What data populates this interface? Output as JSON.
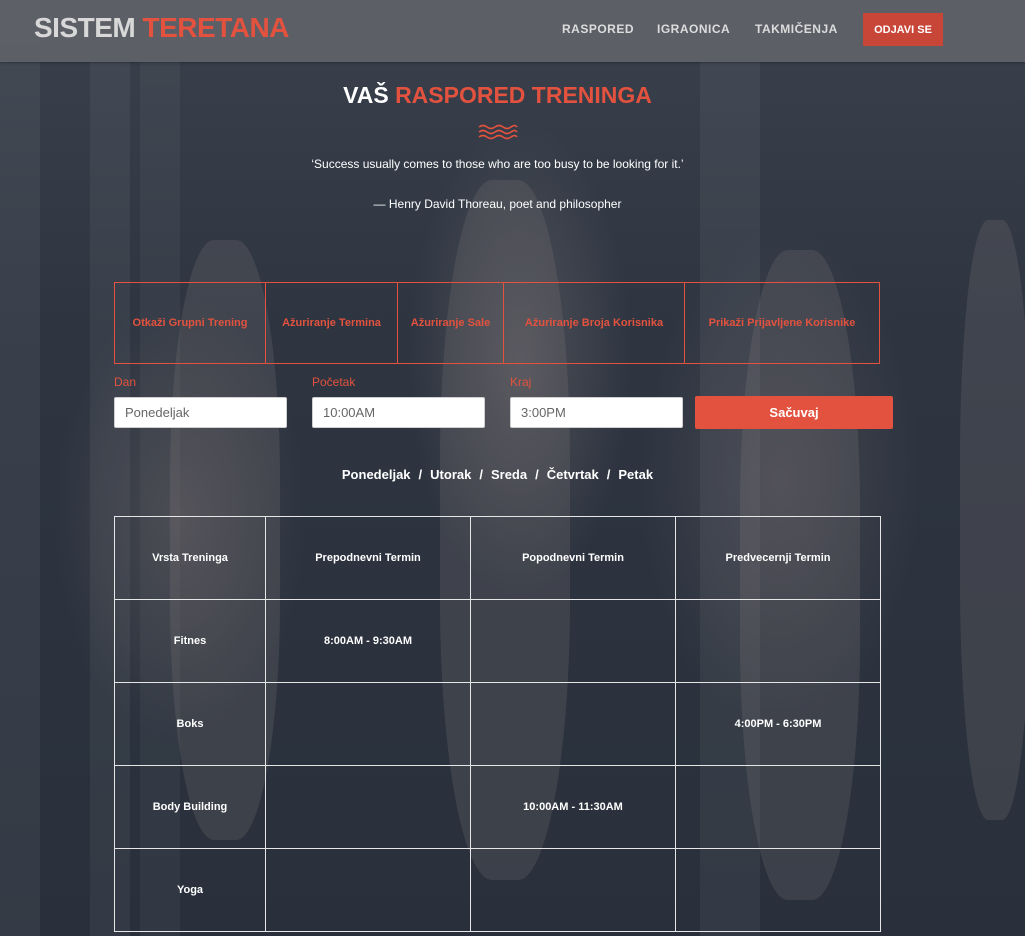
{
  "navbar": {
    "logo_part1": "SISTEM",
    "logo_part2": "TERETANA",
    "links": [
      "RASPORED",
      "IGRAONICA",
      "TAKMIČENJA"
    ],
    "logout": "ODJAVI SE"
  },
  "hero": {
    "title_white": "VAŠ",
    "title_red": "RASPORED TRENINGA",
    "quote": "‘Success usually comes to those who are too busy to be looking for it.’",
    "author": "— Henry David Thoreau, poet and philosopher"
  },
  "actions": [
    "Otkaži Grupni Trening",
    "Ažuriranje Termina",
    "Ažuriranje Sale",
    "Ažuriranje Broja Korisnika",
    "Prikaži Prijavljene Korisnike"
  ],
  "form": {
    "day_label": "Dan",
    "day_placeholder": "Ponedeljak",
    "start_label": "Početak",
    "start_placeholder": "10:00AM",
    "end_label": "Kraj",
    "end_placeholder": "3:00PM",
    "save": "Sačuvaj"
  },
  "days": [
    "Ponedeljak",
    "Utorak",
    "Sreda",
    "Četvrtak",
    "Petak"
  ],
  "table": {
    "headers": [
      "Vrsta Treninga",
      "Prepodnevni Termin",
      "Popodnevni Termin",
      "Predvecernji Termin"
    ],
    "rows": [
      [
        "Fitnes",
        "8:00AM - 9:30AM",
        "",
        ""
      ],
      [
        "Boks",
        "",
        "",
        "4:00PM - 6:30PM"
      ],
      [
        "Body Building",
        "",
        "10:00AM - 11:30AM",
        ""
      ],
      [
        "Yoga",
        "",
        "",
        ""
      ]
    ]
  },
  "colors": {
    "accent": "#e3523e",
    "navbar": "#5f6268",
    "background": "#2b3340"
  }
}
